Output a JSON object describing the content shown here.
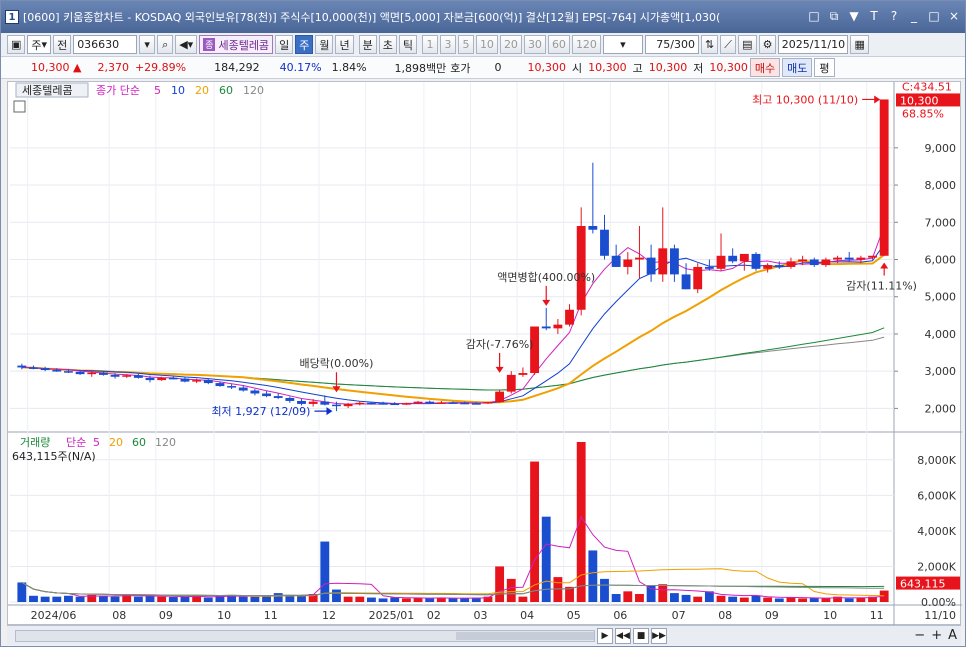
{
  "window": {
    "title": "[0600] 키움종합차트 - KOSDAQ 외국인보유[78(천)] 주식수[10,000(천)] 액면[5,000] 자본금[600(억)] 결산[12월] EPS[-764] 시가총액[1,030(",
    "icon_label": "1",
    "controls": [
      "□",
      "⧉",
      "▼",
      "T",
      "?",
      "_",
      "□",
      "×"
    ]
  },
  "toolbar": {
    "market_select": "주",
    "prev_label": "전",
    "code": "036630",
    "stock_badge": "종",
    "stock_name": "세종텔레콤",
    "periods": [
      "일",
      "주",
      "월",
      "년"
    ],
    "active_period": "주",
    "time_units": [
      "분",
      "초",
      "틱"
    ],
    "minute_options": [
      "1",
      "3",
      "5",
      "10",
      "20",
      "30",
      "60",
      "120"
    ],
    "count": "75",
    "count_total": "/300",
    "date": "2025/11/10"
  },
  "quote": {
    "price": "10,300",
    "change": "2,370",
    "change_pct": "+29.89%",
    "volume": "184,292",
    "vol_ratio": "40.17%",
    "turnover": "1.84%",
    "amount": "1,898백만",
    "hoga_label": "호가",
    "hoga_value": "0",
    "hoga_price": "10,300",
    "open_label": "시",
    "open": "10,300",
    "high_label": "고",
    "high": "10,300",
    "low_label": "저",
    "low": "10,300",
    "buy": "매수",
    "sell": "매도",
    "avg": "평"
  },
  "chart_data": {
    "type": "candlestick",
    "legend": {
      "stock": "세종텔레콤",
      "series_label": "종가 단순",
      "ma_periods": [
        "5",
        "10",
        "20",
        "60",
        "120"
      ],
      "ma_colors": [
        "#d020c0",
        "#1040d0",
        "#f0a000",
        "#1a8a3a",
        "#888888"
      ]
    },
    "right_top_label": "C:434.51",
    "current_price_label": "10,300",
    "current_pct_label": "68.85%",
    "price_axis": [
      2000,
      3000,
      4000,
      5000,
      6000,
      7000,
      8000,
      9000
    ],
    "price_axis_labels": [
      "2,000",
      "3,000",
      "4,000",
      "5,000",
      "6,000",
      "7,000",
      "8,000",
      "9,000"
    ],
    "ylim": [
      1500,
      10500
    ],
    "candles": [
      [
        3150,
        3200,
        3050,
        3100
      ],
      [
        3100,
        3150,
        3050,
        3080
      ],
      [
        3080,
        3120,
        3000,
        3030
      ],
      [
        3030,
        3080,
        2980,
        3000
      ],
      [
        3000,
        3050,
        2950,
        2980
      ],
      [
        2980,
        3020,
        2900,
        2920
      ],
      [
        2920,
        3000,
        2850,
        2960
      ],
      [
        2960,
        2990,
        2880,
        2900
      ],
      [
        2900,
        2950,
        2800,
        2850
      ],
      [
        2850,
        2920,
        2820,
        2890
      ],
      [
        2890,
        2930,
        2800,
        2820
      ],
      [
        2820,
        2880,
        2700,
        2760
      ],
      [
        2760,
        2850,
        2740,
        2820
      ],
      [
        2820,
        2880,
        2780,
        2800
      ],
      [
        2800,
        2830,
        2700,
        2720
      ],
      [
        2720,
        2800,
        2680,
        2760
      ],
      [
        2760,
        2800,
        2650,
        2680
      ],
      [
        2680,
        2720,
        2580,
        2600
      ],
      [
        2600,
        2650,
        2520,
        2560
      ],
      [
        2560,
        2620,
        2450,
        2480
      ],
      [
        2480,
        2520,
        2350,
        2400
      ],
      [
        2400,
        2460,
        2300,
        2330
      ],
      [
        2330,
        2400,
        2250,
        2280
      ],
      [
        2280,
        2320,
        2150,
        2200
      ],
      [
        2200,
        2250,
        2080,
        2120
      ],
      [
        2120,
        2250,
        2050,
        2180
      ],
      [
        2180,
        2350,
        2080,
        2100
      ],
      [
        2100,
        2180,
        1927,
        2060
      ],
      [
        2060,
        2150,
        2010,
        2120
      ],
      [
        2120,
        2180,
        2080,
        2150
      ],
      [
        2150,
        2170,
        2110,
        2140
      ],
      [
        2140,
        2180,
        2100,
        2130
      ],
      [
        2130,
        2170,
        2100,
        2110
      ],
      [
        2110,
        2150,
        2090,
        2140
      ],
      [
        2140,
        2200,
        2120,
        2180
      ],
      [
        2180,
        2210,
        2120,
        2150
      ],
      [
        2150,
        2200,
        2130,
        2160
      ],
      [
        2160,
        2190,
        2130,
        2150
      ],
      [
        2150,
        2180,
        2120,
        2140
      ],
      [
        2140,
        2170,
        2110,
        2130
      ],
      [
        2130,
        2180,
        2120,
        2170
      ],
      [
        2170,
        2500,
        2150,
        2450
      ],
      [
        2450,
        3000,
        2400,
        2900
      ],
      [
        2900,
        3100,
        2850,
        2950
      ],
      [
        2950,
        4200,
        2900,
        4200
      ],
      [
        4200,
        4700,
        4100,
        4150
      ],
      [
        4150,
        4400,
        4000,
        4250
      ],
      [
        4250,
        4800,
        4200,
        4650
      ],
      [
        4650,
        7400,
        4500,
        6900
      ],
      [
        6900,
        8600,
        6700,
        6800
      ],
      [
        6800,
        7200,
        6000,
        6100
      ],
      [
        6100,
        6400,
        5800,
        5800
      ],
      [
        5800,
        6200,
        5600,
        6000
      ],
      [
        6000,
        6900,
        5500,
        6050
      ],
      [
        6050,
        6400,
        5400,
        5600
      ],
      [
        5600,
        7400,
        5400,
        6300
      ],
      [
        6300,
        6400,
        5400,
        5600
      ],
      [
        5600,
        5900,
        5200,
        5200
      ],
      [
        5200,
        5900,
        5100,
        5800
      ],
      [
        5800,
        6000,
        5700,
        5750
      ],
      [
        5750,
        6700,
        5700,
        6100
      ],
      [
        6100,
        6300,
        5900,
        5950
      ],
      [
        5950,
        6100,
        5700,
        6150
      ],
      [
        6150,
        6200,
        5700,
        5750
      ],
      [
        5750,
        5900,
        5650,
        5850
      ],
      [
        5850,
        5950,
        5750,
        5800
      ],
      [
        5800,
        6050,
        5750,
        5950
      ],
      [
        5950,
        6100,
        5850,
        6000
      ],
      [
        6000,
        6050,
        5800,
        5850
      ],
      [
        5850,
        6050,
        5800,
        6000
      ],
      [
        6000,
        6100,
        5900,
        6050
      ],
      [
        6050,
        6200,
        5950,
        6000
      ],
      [
        6000,
        6100,
        5900,
        6050
      ],
      [
        6050,
        6100,
        6000,
        6100
      ],
      [
        6100,
        10300,
        6100,
        10300
      ]
    ],
    "annotations": [
      {
        "text": "배당락(0.00%)",
        "index": 27,
        "price": 2380,
        "pos": "above"
      },
      {
        "text": "감자(-7.76%)",
        "index": 41,
        "price": 2900,
        "pos": "above"
      },
      {
        "text": "액면병합(400.00%)",
        "index": 45,
        "price": 4700,
        "pos": "above"
      },
      {
        "text": "감자(11.11%)",
        "index": 74,
        "price": 6000,
        "pos": "below"
      },
      {
        "text": "최고 10,300 (11/10)",
        "index": 74,
        "price": 10300,
        "pos": "left"
      },
      {
        "text": "최저 1,927 (12/09)",
        "index": 27,
        "price": 1927,
        "pos": "left"
      }
    ],
    "volume_legend": {
      "label": "거래량",
      "series_label": "단순",
      "ma_periods": [
        "5",
        "20",
        "60",
        "120"
      ],
      "sub": "643,115주(N/A)"
    },
    "volume_axis": [
      0,
      2000,
      4000,
      6000,
      8000
    ],
    "volume_axis_labels": [
      "0.00%",
      "2,000K",
      "4,000K",
      "6,000K",
      "8,000K"
    ],
    "volume_current_label": "643,115",
    "volume_ylim": [
      0,
      9000
    ],
    "volumes": [
      1100,
      350,
      300,
      300,
      350,
      300,
      400,
      350,
      300,
      400,
      300,
      350,
      300,
      280,
      300,
      350,
      250,
      350,
      400,
      300,
      300,
      350,
      500,
      400,
      350,
      450,
      3400,
      700,
      300,
      300,
      250,
      200,
      250,
      200,
      250,
      200,
      250,
      200,
      200,
      250,
      300,
      2000,
      1300,
      300,
      7900,
      4800,
      1400,
      850,
      9000,
      2900,
      1300,
      450,
      600,
      450,
      900,
      1000,
      500,
      400,
      300,
      600,
      350,
      300,
      250,
      350,
      250,
      200,
      250,
      200,
      250,
      200,
      300,
      200,
      250,
      300,
      643
    ],
    "x_labels": [
      {
        "text": "2024/06",
        "index": 1
      },
      {
        "text": "08",
        "index": 8
      },
      {
        "text": "09",
        "index": 12
      },
      {
        "text": "10",
        "index": 17
      },
      {
        "text": "11",
        "index": 21
      },
      {
        "text": "12",
        "index": 26
      },
      {
        "text": "2025/01",
        "index": 30
      },
      {
        "text": "02",
        "index": 35
      },
      {
        "text": "03",
        "index": 39
      },
      {
        "text": "04",
        "index": 43
      },
      {
        "text": "05",
        "index": 47
      },
      {
        "text": "06",
        "index": 51
      },
      {
        "text": "07",
        "index": 56
      },
      {
        "text": "08",
        "index": 60
      },
      {
        "text": "09",
        "index": 64
      },
      {
        "text": "10",
        "index": 69
      },
      {
        "text": "11",
        "index": 73
      }
    ],
    "x_right_label": "11/10"
  }
}
